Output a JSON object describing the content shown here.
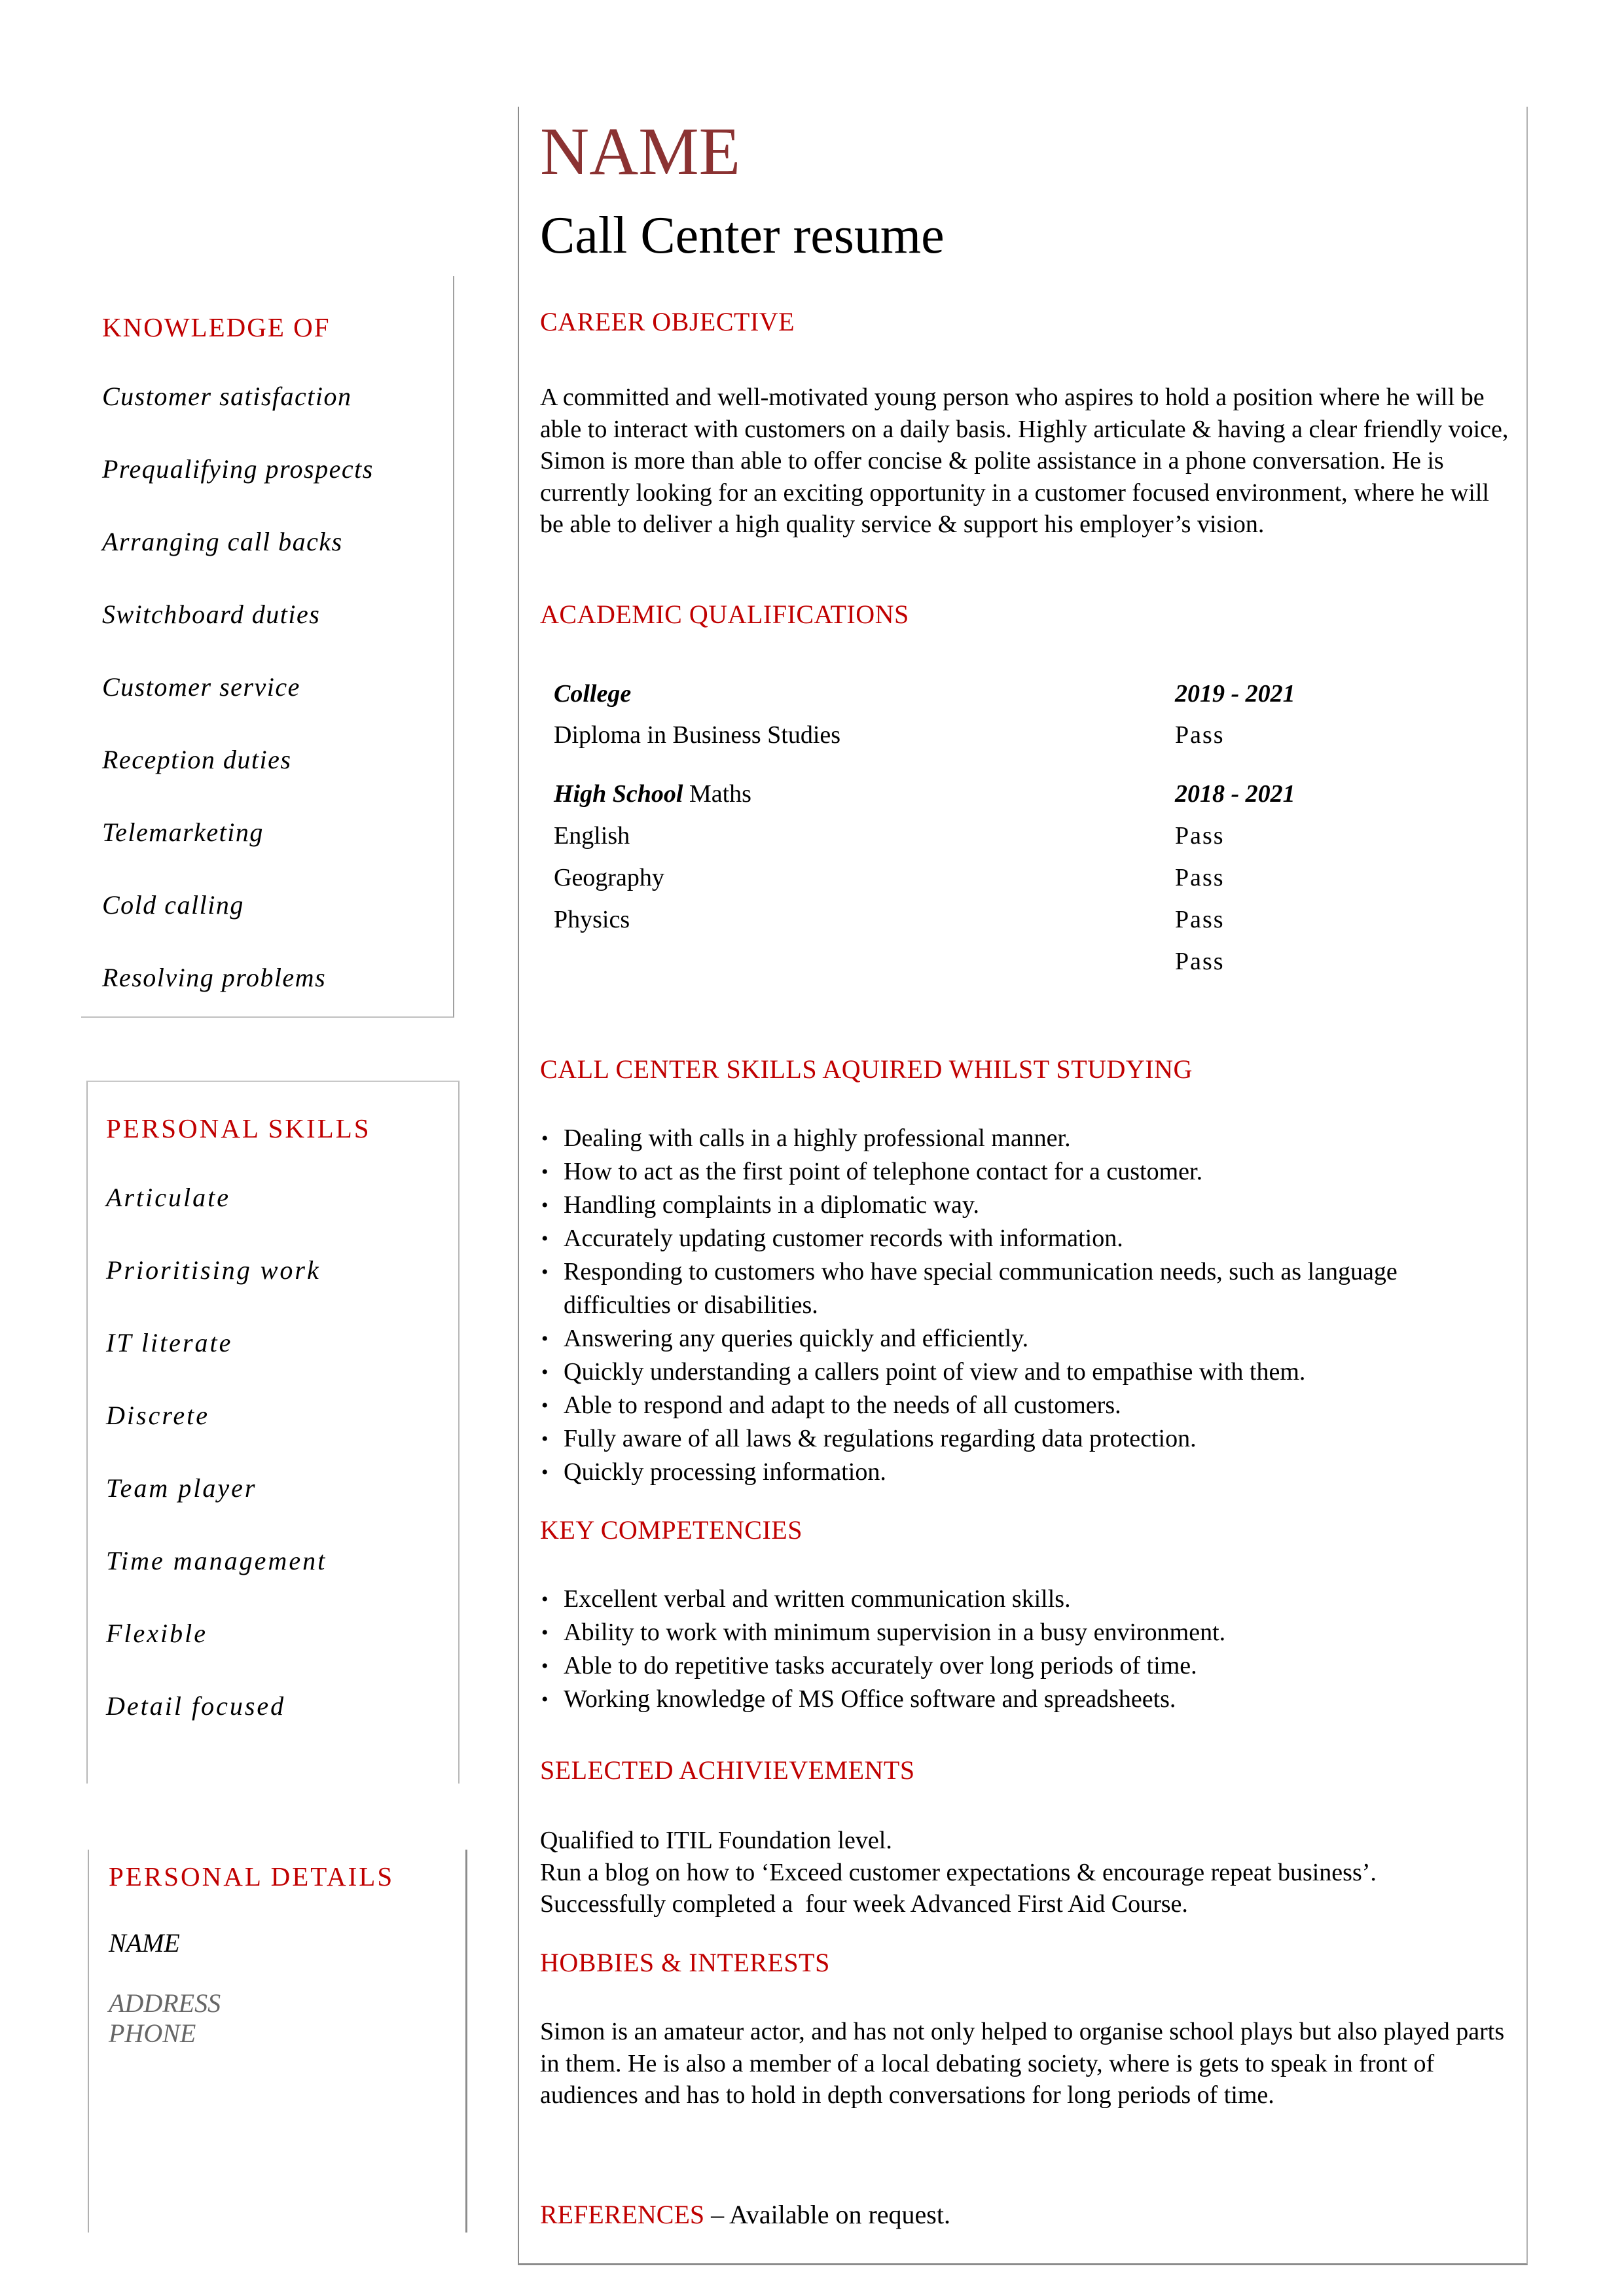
{
  "header": {
    "name": "NAME",
    "title": "Call Center resume"
  },
  "colors": {
    "accent_red": "#c00000",
    "name_maroon": "#8b3232",
    "muted_grey": "#666666"
  },
  "sidebar": {
    "knowledge": {
      "heading": "KNOWLEDGE OF",
      "items": [
        "Customer satisfaction",
        "Prequalifying prospects",
        "Arranging call backs",
        "Switchboard duties",
        "Customer service",
        "Reception duties",
        "Telemarketing",
        "Cold calling",
        "Resolving problems"
      ]
    },
    "personal_skills": {
      "heading": "PERSONAL SKILLS",
      "items": [
        "Articulate",
        "Prioritising work",
        "IT literate",
        "Discrete",
        "Team player",
        "Time management",
        "Flexible",
        "Detail focused"
      ]
    },
    "personal_details": {
      "heading": "PERSONAL DETAILS",
      "name": "NAME",
      "address": "ADDRESS",
      "phone": "PHONE"
    }
  },
  "main": {
    "career_objective": {
      "heading": "CAREER OBJECTIVE",
      "text": "A committed and well-motivated young person who aspires to hold a position where he will be able to interact with customers on a daily basis. Highly articulate & having a clear friendly voice, Simon is more than able to offer concise & polite assistance in a phone conversation. He is currently looking for an exciting opportunity in a customer focused environment, where he will be able to deliver a high quality service & support his employer’s vision."
    },
    "academic": {
      "heading": "ACADEMIC QUALIFICATIONS",
      "college": {
        "label": "College",
        "years": "2019 - 2021",
        "course": "Diploma in Business Studies",
        "result": "Pass"
      },
      "high_school": {
        "label": "High School",
        "first_subject": "Maths",
        "years": "2018 - 2021",
        "subjects": [
          "English",
          "Geography",
          "Physics"
        ],
        "results": [
          "Pass",
          "Pass",
          "Pass",
          "Pass"
        ]
      }
    },
    "call_center_skills": {
      "heading": "CALL CENTER SKILLS AQUIRED WHILST STUDYING",
      "items": [
        "Dealing with calls in a highly professional manner.",
        "How to act as the first point of telephone contact for a customer.",
        "Handling complaints in a diplomatic way.",
        "Accurately updating customer records with information.",
        "Responding to customers who have special communication needs, such as language difficulties or disabilities.",
        "Answering any queries quickly and efficiently.",
        "Quickly understanding a callers point of view and to empathise with them.",
        "Able to respond and adapt to the needs of all customers.",
        "Fully aware of all laws & regulations regarding data protection.",
        "Quickly processing information."
      ]
    },
    "key_competencies": {
      "heading": "KEY COMPETENCIES",
      "items": [
        "Excellent verbal and written communication skills.",
        "Ability to work with minimum supervision in a busy environment.",
        "Able to do repetitive tasks accurately over long periods of time.",
        "Working knowledge of MS Office software and spreadsheets."
      ]
    },
    "achievements": {
      "heading": "SELECTED ACHIVIEVEMENTS",
      "lines": [
        "Qualified to ITIL Foundation level.",
        "Run a blog on how to ‘Exceed customer expectations & encourage repeat business’.",
        "Successfully completed a  four week Advanced First Aid Course."
      ]
    },
    "hobbies": {
      "heading": "HOBBIES & INTERESTS",
      "text": "Simon is an amateur actor, and has not only helped to organise school plays but also played parts in them. He is also a member of a local debating society, where is gets to speak in front of audiences and has to hold in depth conversations for long periods of time."
    },
    "references": {
      "heading": "REFERENCES",
      "text": " – Available on request."
    }
  }
}
